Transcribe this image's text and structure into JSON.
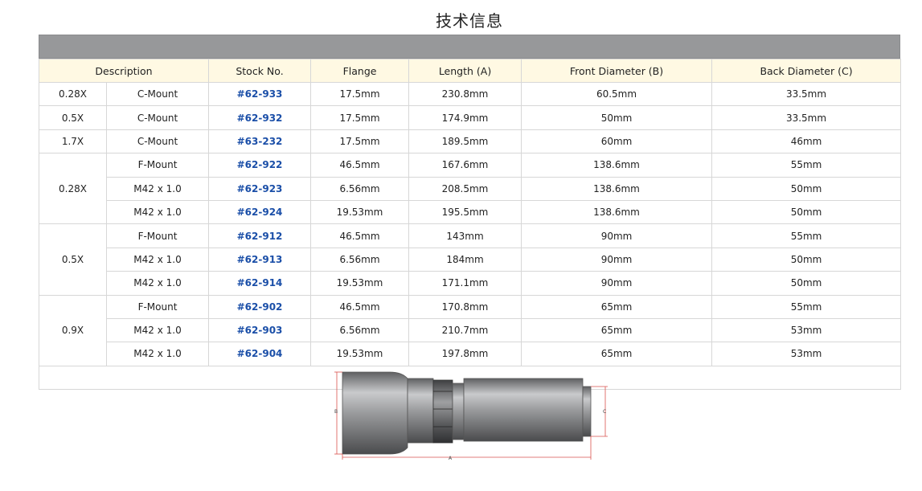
{
  "page": {
    "title": "技术信息"
  },
  "table": {
    "headers": {
      "description": "Description",
      "stock": "Stock No.",
      "flange": "Flange",
      "length": "Length (A)",
      "front": "Front Diameter (B)",
      "back": "Back Diameter (C)"
    },
    "rows": [
      {
        "mag": "0.28X",
        "mount": "C-Mount",
        "stock": "#62-933",
        "flange": "17.5mm",
        "length": "230.8mm",
        "front": "60.5mm",
        "back": "33.5mm"
      },
      {
        "mag": "0.5X",
        "mount": "C-Mount",
        "stock": "#62-932",
        "flange": "17.5mm",
        "length": "174.9mm",
        "front": "50mm",
        "back": "33.5mm"
      },
      {
        "mag": "1.7X",
        "mount": "C-Mount",
        "stock": "#63-232",
        "flange": "17.5mm",
        "length": "189.5mm",
        "front": "60mm",
        "back": "46mm"
      },
      {
        "mag": "0.28X",
        "mount": "F-Mount",
        "stock": "#62-922",
        "flange": "46.5mm",
        "length": "167.6mm",
        "front": "138.6mm",
        "back": "55mm"
      },
      {
        "mag": "",
        "mount": "M42 x 1.0",
        "stock": "#62-923",
        "flange": "6.56mm",
        "length": "208.5mm",
        "front": "138.6mm",
        "back": "50mm"
      },
      {
        "mag": "",
        "mount": "M42 x 1.0",
        "stock": "#62-924",
        "flange": "19.53mm",
        "length": "195.5mm",
        "front": "138.6mm",
        "back": "50mm"
      },
      {
        "mag": "0.5X",
        "mount": "F-Mount",
        "stock": "#62-912",
        "flange": "46.5mm",
        "length": "143mm",
        "front": "90mm",
        "back": "55mm"
      },
      {
        "mag": "",
        "mount": "M42 x 1.0",
        "stock": "#62-913",
        "flange": "6.56mm",
        "length": "184mm",
        "front": "90mm",
        "back": "50mm"
      },
      {
        "mag": "",
        "mount": "M42 x 1.0",
        "stock": "#62-914",
        "flange": "19.53mm",
        "length": "171.1mm",
        "front": "90mm",
        "back": "50mm"
      },
      {
        "mag": "0.9X",
        "mount": "F-Mount",
        "stock": "#62-902",
        "flange": "46.5mm",
        "length": "170.8mm",
        "front": "65mm",
        "back": "55mm"
      },
      {
        "mag": "",
        "mount": "M42 x 1.0",
        "stock": "#62-903",
        "flange": "6.56mm",
        "length": "210.7mm",
        "front": "65mm",
        "back": "53mm"
      },
      {
        "mag": "",
        "mount": "M42 x 1.0",
        "stock": "#62-904",
        "flange": "19.53mm",
        "length": "197.8mm",
        "front": "65mm",
        "back": "53mm"
      }
    ]
  },
  "diagram": {
    "label_a": "A",
    "label_b": "B",
    "label_c": "C"
  },
  "colors": {
    "link": "#1b4fa8",
    "header_bg": "#fff9e3",
    "band": "#97989a",
    "dimension": "#d9534f"
  }
}
